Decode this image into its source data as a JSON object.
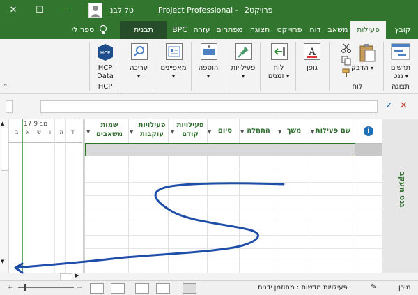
{
  "titlebar": {
    "file_title": "פרויקט2",
    "app_title": "Project Professional -",
    "user_name": "טל לבנון",
    "minimize": "—",
    "maximize": "☐",
    "close": "✕"
  },
  "tabs": [
    "קובץ",
    "פעילות",
    "משאב",
    "דוח",
    "פרוייקט",
    "תצוגה",
    "מפתחים",
    "עזרה",
    "BPC",
    "תבנית"
  ],
  "tell_me": "ספר לי",
  "ribbon": {
    "gantt": "תרשים",
    "gantt2": "גנט",
    "views_group": "תצוגה",
    "paste": "הדבק",
    "clipboard_group": "לוח",
    "font_btn": "גופן",
    "schedule": "לוח",
    "schedule2": "זמנים",
    "tasks": "פעילויות",
    "insert": "הוספה",
    "properties": "מאפיינים",
    "editing": "עריכה",
    "hcp1": "HCP",
    "hcp2": "Data",
    "hcp_group": "HCP"
  },
  "formula_bar": {
    "cancel": "✕",
    "confirm": "✓",
    "value": ""
  },
  "table": {
    "info_icon": "i",
    "headers": [
      {
        "l1": "שם פעילות",
        "l2": ""
      },
      {
        "l1": "משך",
        "l2": ""
      },
      {
        "l1": "התחלה",
        "l2": ""
      },
      {
        "l1": "סיום",
        "l2": ""
      },
      {
        "l1": "פעילויות",
        "l2": "קודם"
      },
      {
        "l1": "פעילויות",
        "l2": "עוקבות"
      },
      {
        "l1": "שמות",
        "l2": "משאבים"
      }
    ]
  },
  "side_label": "גנט מעקב",
  "timescale": {
    "date": "17 נוב 9",
    "days": [
      "ב",
      "א",
      "ש",
      "ו",
      "ה",
      "ד"
    ]
  },
  "status": {
    "ready": "מוכן",
    "new_tasks": "פעילויות חדשות : מתוזמן ידנית",
    "zoom_minus": "−",
    "zoom_plus": "+"
  },
  "colors": {
    "accent": "#31752f",
    "accent_dark": "#264c29",
    "pen": "#1f4ea8"
  }
}
